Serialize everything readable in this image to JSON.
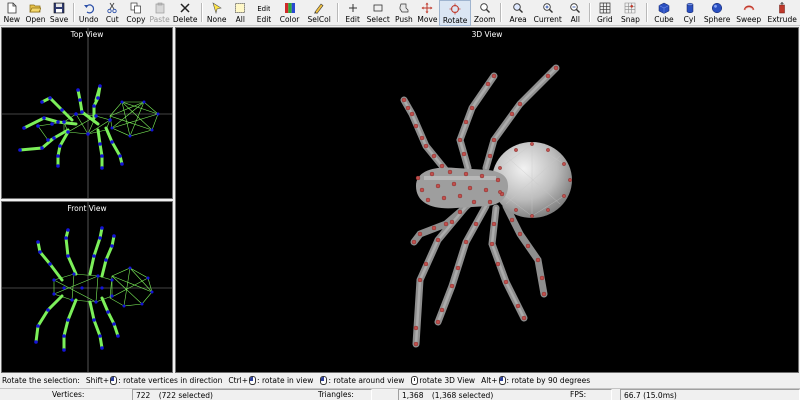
{
  "toolbar": {
    "items": [
      {
        "label": "New",
        "icon": "new-file-icon"
      },
      {
        "label": "Open",
        "icon": "open-folder-icon"
      },
      {
        "label": "Save",
        "icon": "save-icon"
      },
      {
        "label": "Undo",
        "icon": "undo-icon"
      },
      {
        "label": "Cut",
        "icon": "cut-icon"
      },
      {
        "label": "Copy",
        "icon": "copy-icon"
      },
      {
        "label": "Paste",
        "icon": "paste-icon",
        "disabled": true
      },
      {
        "label": "Delete",
        "icon": "delete-icon"
      },
      {
        "label": "None",
        "icon": "select-none-icon"
      },
      {
        "label": "All",
        "icon": "select-all-icon"
      },
      {
        "label": "Edit",
        "icon": "edit-selection-icon",
        "top": "Edit"
      },
      {
        "label": "Color",
        "icon": "color-icon"
      },
      {
        "label": "SelCol",
        "icon": "select-color-icon"
      },
      {
        "label": "Edit",
        "icon": "edit-mode-icon"
      },
      {
        "label": "Select",
        "icon": "select-mode-icon"
      },
      {
        "label": "Push",
        "icon": "push-mode-icon"
      },
      {
        "label": "Move",
        "icon": "move-mode-icon"
      },
      {
        "label": "Rotate",
        "icon": "rotate-mode-icon",
        "active": true
      },
      {
        "label": "Zoom",
        "icon": "zoom-mode-icon"
      },
      {
        "label": "Area",
        "icon": "zoom-area-icon"
      },
      {
        "label": "Current",
        "icon": "zoom-current-icon"
      },
      {
        "label": "All",
        "icon": "zoom-all-icon"
      },
      {
        "label": "Grid",
        "icon": "grid-icon"
      },
      {
        "label": "Snap",
        "icon": "snap-icon"
      },
      {
        "label": "Cube",
        "icon": "cube-icon"
      },
      {
        "label": "Cyl",
        "icon": "cylinder-icon"
      },
      {
        "label": "Sphere",
        "icon": "sphere-icon"
      },
      {
        "label": "Sweep",
        "icon": "sweep-icon"
      },
      {
        "label": "Extrude",
        "icon": "extrude-icon"
      }
    ]
  },
  "views": {
    "top": {
      "title": "Top View"
    },
    "front": {
      "title": "Front View"
    },
    "main": {
      "title": "3D View"
    }
  },
  "hints": {
    "prefix": "Rotate the selection:",
    "items": [
      {
        "mod": "Shift+",
        "text": ": rotate vertices in direction"
      },
      {
        "mod": "Ctrl+",
        "text": ": rotate in view"
      },
      {
        "mod": "",
        "text": ": rotate around view"
      },
      {
        "mod": "",
        "text": "rotate 3D View"
      },
      {
        "mod": "Alt+",
        "text": ": rotate by 90 degrees"
      }
    ]
  },
  "status": {
    "vertices_label": "Vertices:",
    "vertices_value": "722",
    "vertices_selected": "(722 selected)",
    "triangles_label": "Triangles:",
    "triangles_value": "1,368",
    "triangles_selected": "(1,368 selected)",
    "fps_label": "FPS:",
    "fps_value": "66.7 (15.0ms)"
  },
  "colors": {
    "viewport_bg": "#000000",
    "ortho_mesh_edges": "#7cf05a",
    "ortho_mesh_vertices": "#1414d8",
    "mesh_shading": "#9a9a9a",
    "selected_vertices": "#c0504d",
    "active_tool_bg": "#dbe6f3"
  }
}
